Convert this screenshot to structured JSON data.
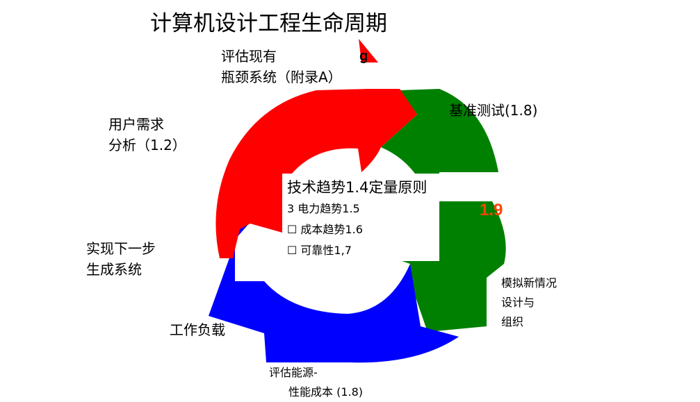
{
  "title": "计算机设计工程生命周期",
  "labels": {
    "evaluate_existing": [
      "评估现有",
      "瓶颈系统（附录A）"
    ],
    "user_needs": [
      "用户需求",
      "分析（1.2）"
    ],
    "implement_next": [
      "实现下一步",
      "生成系统"
    ],
    "workload": "工作负载",
    "energy_cost": [
      "评估能源-",
      "性能成本 (1.8)"
    ],
    "simulate": [
      "模拟新情况",
      "设计与",
      "组织"
    ],
    "benchmark": "基准测试(1.8)",
    "step_19": "1.9",
    "fragment_g": "g"
  },
  "center": {
    "title": "技术趋势1.4定量原则",
    "items": [
      "3 电力趋势1.5",
      "☐ 成本趋势1.6",
      "☐ 可靠性1,7"
    ]
  },
  "colors": {
    "red": "#ff0000",
    "green": "#008000",
    "blue": "#0000ff",
    "accent": "#ff4500"
  }
}
